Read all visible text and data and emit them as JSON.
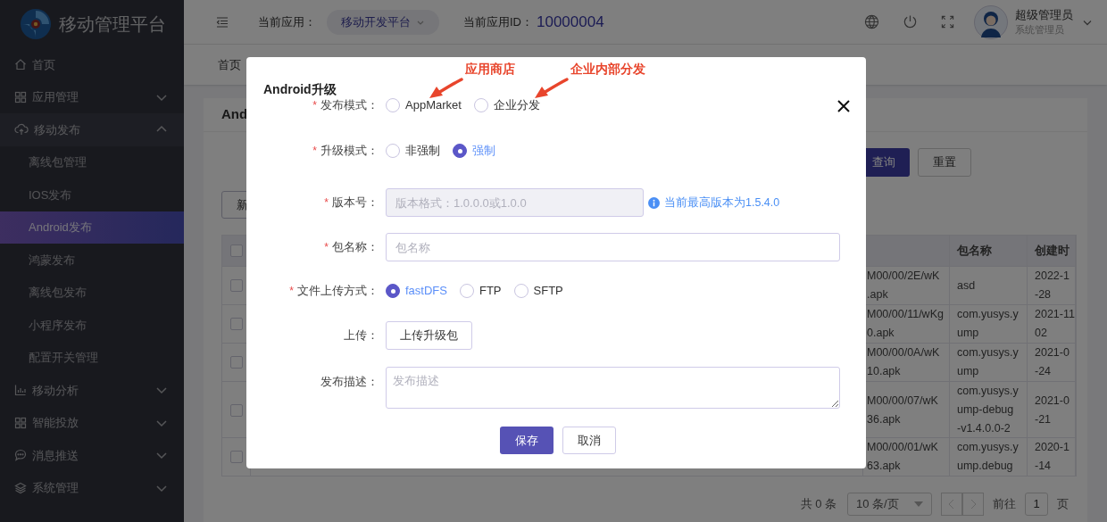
{
  "sidebar": {
    "logo_text": "移动管理平台",
    "items": [
      {
        "kind": "link",
        "label": "首页"
      },
      {
        "kind": "group",
        "label": "应用管理",
        "expanded": false
      },
      {
        "kind": "group",
        "label": "移动发布",
        "expanded": true,
        "children": [
          {
            "label": "离线包管理",
            "selected": false
          },
          {
            "label": "IOS发布",
            "selected": false
          },
          {
            "label": "Android发布",
            "selected": true
          },
          {
            "label": "鸿蒙发布",
            "selected": false
          },
          {
            "label": "离线包发布",
            "selected": false
          },
          {
            "label": "小程序发布",
            "selected": false
          },
          {
            "label": "配置开关管理",
            "selected": false
          }
        ]
      },
      {
        "kind": "group",
        "label": "移动分析",
        "expanded": false
      },
      {
        "kind": "group",
        "label": "智能投放",
        "expanded": false
      },
      {
        "kind": "group",
        "label": "消息推送",
        "expanded": false
      },
      {
        "kind": "group",
        "label": "系统管理",
        "expanded": false
      }
    ]
  },
  "header": {
    "current_app_label": "当前应用：",
    "current_app": "移动开发平台",
    "app_id_label": "当前应用ID：",
    "app_id": "10000004",
    "user_name": "超级管理员",
    "user_role": "系统管理员"
  },
  "tabs": [
    {
      "label": "首页",
      "selected": false
    }
  ],
  "panel": {
    "title": "And",
    "new_button": "新",
    "query_button": "查询",
    "reset_button": "重置",
    "table": {
      "columns": [
        "包名称",
        "创建时"
      ],
      "select_all_checked": false,
      "rows": [
        {
          "checked": false,
          "file_path": "M00/00/2E/wK\n.apk",
          "package": "asd",
          "created": "2022-1\n-28"
        },
        {
          "checked": false,
          "file_path": "M00/00/11/wKg\n0.apk",
          "package": "com.yusys.y\nump",
          "created": "2021-11\n02"
        },
        {
          "checked": false,
          "file_path": "M00/00/0A/wK\n10.apk",
          "package": "com.yusys.y\nump",
          "created": "2021-0\n-24"
        },
        {
          "checked": false,
          "file_path": "M00/00/07/wK\n36.apk",
          "package": "com.yusys.y\nump-debug\n-v1.4.0.0-2",
          "created": "2021-0\n-21"
        },
        {
          "checked": false,
          "file_path": "M00/00/01/wK\n63.apk",
          "package": "com.yusys.y\nump.debug",
          "created": "2020-1\n-14"
        }
      ]
    },
    "pagination": {
      "total": "共 0 条",
      "page_size": "10 条/页",
      "goto_label": "前往",
      "page": "1",
      "page_suffix": "页"
    }
  },
  "dialog": {
    "title": "Android升级",
    "annotations": [
      "应用商店",
      "企业内部分发"
    ],
    "fields": [
      {
        "kind": "radio",
        "label": "发布模式：",
        "required_mark": "*",
        "options": [
          {
            "label": "AppMarket",
            "selected": false
          },
          {
            "label": "企业分发",
            "selected": false
          }
        ]
      },
      {
        "kind": "radio",
        "label": "升级模式：",
        "required_mark": "*",
        "options": [
          {
            "label": "非强制",
            "selected": false
          },
          {
            "label": "强制",
            "selected": true
          }
        ]
      },
      {
        "kind": "input",
        "label": "版本号：",
        "required_mark": "*",
        "placeholder": "版本格式：1.0.0.0或1.0.0",
        "disabled": true,
        "hint": "当前最高版本为1.5.4.0"
      },
      {
        "kind": "input",
        "label": "包名称：",
        "required_mark": "*",
        "placeholder": "包名称",
        "disabled": false
      },
      {
        "kind": "radio",
        "label": "文件上传方式：",
        "required_mark": "*",
        "options": [
          {
            "label": "fastDFS",
            "selected": true
          },
          {
            "label": "FTP",
            "selected": false
          },
          {
            "label": "SFTP",
            "selected": false
          }
        ]
      },
      {
        "kind": "upload",
        "label": "上传：",
        "button": "上传升级包"
      },
      {
        "kind": "textarea",
        "label": "发布描述：",
        "placeholder": "发布描述"
      }
    ],
    "buttons": [
      {
        "kind": "primary",
        "label": "保存"
      },
      {
        "kind": "default",
        "label": "取消"
      }
    ]
  }
}
